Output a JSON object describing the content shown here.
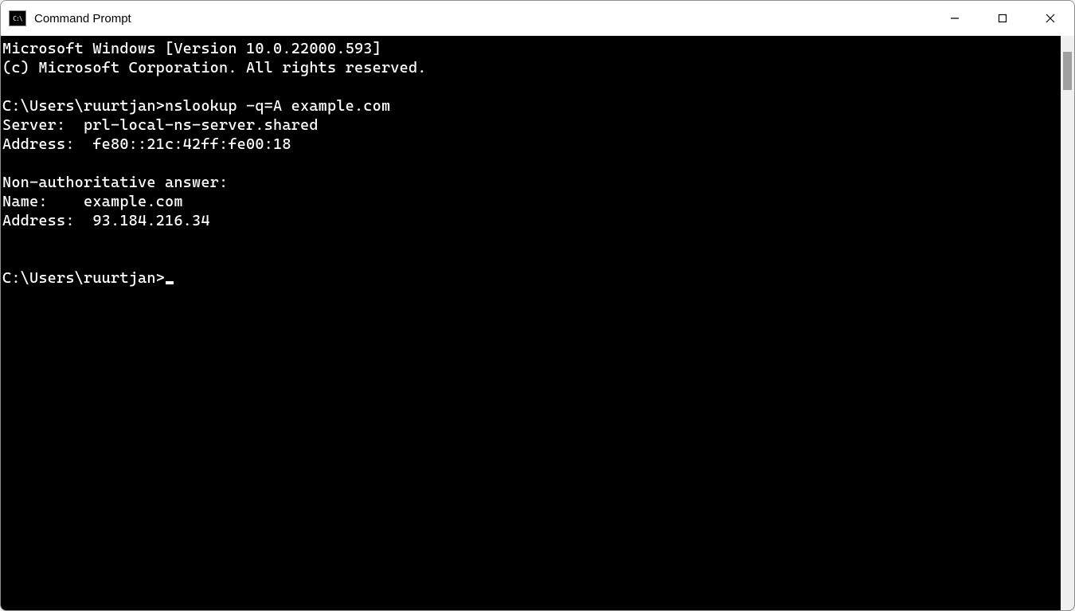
{
  "window": {
    "title": "Command Prompt",
    "icon_label": "cmd-icon"
  },
  "terminal": {
    "lines": [
      "Microsoft Windows [Version 10.0.22000.593]",
      "(c) Microsoft Corporation. All rights reserved.",
      "",
      "C:\\Users\\ruurtjan>nslookup -q=A example.com",
      "Server:  prl-local-ns-server.shared",
      "Address:  fe80::21c:42ff:fe00:18",
      "",
      "Non-authoritative answer:",
      "Name:    example.com",
      "Address:  93.184.216.34",
      "",
      ""
    ],
    "current_prompt": "C:\\Users\\ruurtjan>"
  }
}
